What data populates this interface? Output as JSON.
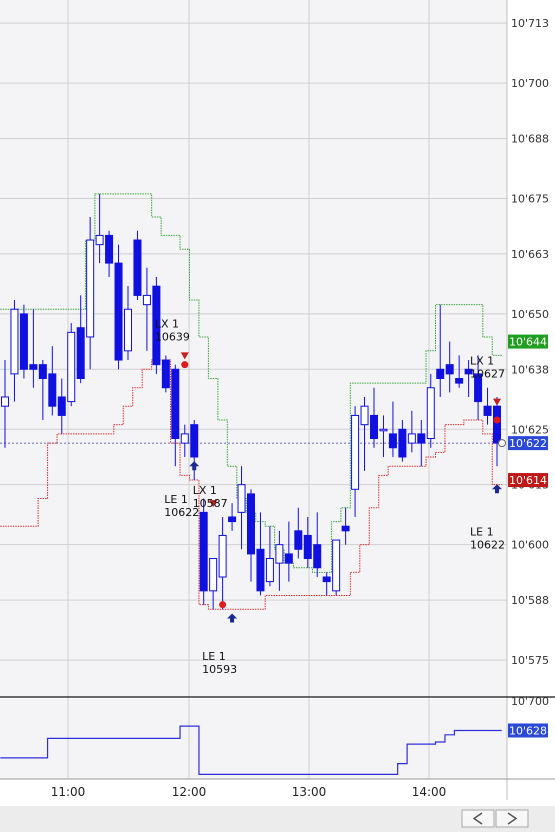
{
  "chart_data": [
    {
      "type": "candlestick",
      "title": "",
      "ylim": [
        10567,
        10718
      ],
      "y_ticks": [
        "10'713",
        "10'700",
        "10'688",
        "10'675",
        "10'663",
        "10'650",
        "10'638",
        "10'625",
        "10'613",
        "10'600",
        "10'588",
        "10'575"
      ],
      "y_tick_values": [
        10713,
        10700,
        10688,
        10675,
        10663,
        10650,
        10638,
        10625,
        10613,
        10600,
        10588,
        10575
      ],
      "time_grid_x": [
        "11:00",
        "12:00",
        "13:00",
        "14:00"
      ],
      "grid": true,
      "candles": [
        {
          "o": 10632,
          "h": 10640,
          "l": 10621,
          "c": 10630,
          "up": true
        },
        {
          "o": 10637,
          "h": 10653,
          "l": 10631,
          "c": 10651,
          "up": true
        },
        {
          "o": 10650,
          "h": 10652,
          "l": 10636,
          "c": 10638,
          "up": false
        },
        {
          "o": 10639,
          "h": 10651,
          "l": 10634,
          "c": 10638,
          "up": false
        },
        {
          "o": 10639,
          "h": 10640,
          "l": 10627,
          "c": 10636,
          "up": false
        },
        {
          "o": 10637,
          "h": 10643,
          "l": 10628,
          "c": 10630,
          "up": false
        },
        {
          "o": 10632,
          "h": 10636,
          "l": 10624,
          "c": 10628,
          "up": false
        },
        {
          "o": 10631,
          "h": 10648,
          "l": 10630,
          "c": 10646,
          "up": true
        },
        {
          "o": 10647,
          "h": 10654,
          "l": 10635,
          "c": 10636,
          "up": false
        },
        {
          "o": 10645,
          "h": 10671,
          "l": 10638,
          "c": 10666,
          "up": true
        },
        {
          "o": 10665,
          "h": 10676,
          "l": 10661,
          "c": 10667,
          "up": true
        },
        {
          "o": 10667,
          "h": 10668,
          "l": 10658,
          "c": 10661,
          "up": false
        },
        {
          "o": 10661,
          "h": 10665,
          "l": 10638,
          "c": 10640,
          "up": false
        },
        {
          "o": 10642,
          "h": 10656,
          "l": 10640,
          "c": 10651,
          "up": true
        },
        {
          "o": 10666,
          "h": 10668,
          "l": 10653,
          "c": 10654,
          "up": false
        },
        {
          "o": 10652,
          "h": 10660,
          "l": 10642,
          "c": 10654,
          "up": true
        },
        {
          "o": 10656,
          "h": 10658,
          "l": 10637,
          "c": 10639,
          "up": false
        },
        {
          "o": 10640,
          "h": 10641,
          "l": 10633,
          "c": 10634,
          "up": false
        },
        {
          "o": 10638,
          "h": 10639,
          "l": 10617,
          "c": 10623,
          "up": false
        },
        {
          "o": 10622,
          "h": 10626,
          "l": 10619,
          "c": 10624,
          "up": true
        },
        {
          "o": 10626,
          "h": 10627,
          "l": 10614,
          "c": 10619,
          "up": false
        },
        {
          "o": 10607,
          "h": 10610,
          "l": 10587,
          "c": 10590,
          "up": false
        },
        {
          "o": 10590,
          "h": 10597,
          "l": 10586,
          "c": 10597,
          "up": true
        },
        {
          "o": 10593,
          "h": 10606,
          "l": 10586,
          "c": 10602,
          "up": true
        },
        {
          "o": 10606,
          "h": 10609,
          "l": 10603,
          "c": 10605,
          "up": false
        },
        {
          "o": 10607,
          "h": 10617,
          "l": 10599,
          "c": 10613,
          "up": true
        },
        {
          "o": 10611,
          "h": 10612,
          "l": 10592,
          "c": 10598,
          "up": false
        },
        {
          "o": 10599,
          "h": 10607,
          "l": 10589,
          "c": 10590,
          "up": false
        },
        {
          "o": 10592,
          "h": 10604,
          "l": 10591,
          "c": 10597,
          "up": true
        },
        {
          "o": 10596,
          "h": 10603,
          "l": 10590,
          "c": 10600,
          "up": true
        },
        {
          "o": 10598,
          "h": 10605,
          "l": 10592,
          "c": 10596,
          "up": false
        },
        {
          "o": 10603,
          "h": 10608,
          "l": 10597,
          "c": 10599,
          "up": false
        },
        {
          "o": 10602,
          "h": 10606,
          "l": 10595,
          "c": 10597,
          "up": false
        },
        {
          "o": 10600,
          "h": 10607,
          "l": 10593,
          "c": 10595,
          "up": false
        },
        {
          "o": 10592,
          "h": 10594,
          "l": 10589,
          "c": 10593,
          "up": false
        },
        {
          "o": 10590,
          "h": 10601,
          "l": 10589,
          "c": 10601,
          "up": true
        },
        {
          "o": 10603,
          "h": 10608,
          "l": 10600,
          "c": 10604,
          "up": false
        },
        {
          "o": 10612,
          "h": 10630,
          "l": 10606,
          "c": 10628,
          "up": true
        },
        {
          "o": 10626,
          "h": 10632,
          "l": 10616,
          "c": 10630,
          "up": true
        },
        {
          "o": 10628,
          "h": 10634,
          "l": 10621,
          "c": 10623,
          "up": false
        },
        {
          "o": 10625,
          "h": 10628,
          "l": 10619,
          "c": 10625,
          "up": true
        },
        {
          "o": 10624,
          "h": 10631,
          "l": 10619,
          "c": 10621,
          "up": false
        },
        {
          "o": 10625,
          "h": 10627,
          "l": 10618,
          "c": 10619,
          "up": false
        },
        {
          "o": 10622,
          "h": 10629,
          "l": 10620,
          "c": 10624,
          "up": true
        },
        {
          "o": 10624,
          "h": 10627,
          "l": 10617,
          "c": 10622,
          "up": false
        },
        {
          "o": 10623,
          "h": 10637,
          "l": 10621,
          "c": 10634,
          "up": true
        },
        {
          "o": 10638,
          "h": 10652,
          "l": 10632,
          "c": 10636,
          "up": false
        },
        {
          "o": 10639,
          "h": 10644,
          "l": 10633,
          "c": 10637,
          "up": false
        },
        {
          "o": 10636,
          "h": 10641,
          "l": 10634,
          "c": 10635,
          "up": false
        },
        {
          "o": 10638,
          "h": 10640,
          "l": 10632,
          "c": 10637,
          "up": false
        },
        {
          "o": 10637,
          "h": 10641,
          "l": 10627,
          "c": 10631,
          "up": false
        },
        {
          "o": 10630,
          "h": 10634,
          "l": 10626,
          "c": 10628,
          "up": false
        },
        {
          "o": 10630,
          "h": 10632,
          "l": 10617,
          "c": 10622,
          "up": false
        }
      ],
      "upper_band": [
        10651,
        10651,
        10651,
        10651,
        10651,
        10651,
        10651,
        10651,
        10651,
        10666,
        10676,
        10676,
        10676,
        10676,
        10676,
        10676,
        10671,
        10667,
        10667,
        10664,
        10653,
        10645,
        10636,
        10627,
        10617,
        10610,
        10607,
        10605,
        10604,
        10599,
        10596,
        10595,
        10595,
        10594,
        10594,
        10605,
        10608,
        10635,
        10635,
        10635,
        10635,
        10635,
        10635,
        10635,
        10635,
        10642,
        10652,
        10652,
        10652,
        10652,
        10652,
        10645,
        10641
      ],
      "lower_band": [
        10604,
        10604,
        10604,
        10604,
        10610,
        10622,
        10624,
        10624,
        10624,
        10624,
        10624,
        10624,
        10626,
        10630,
        10634,
        10638,
        10640,
        10640,
        10622,
        10615,
        10614,
        10587,
        10586,
        10586,
        10586,
        10586,
        10586,
        10586,
        10589,
        10589,
        10589,
        10589,
        10589,
        10589,
        10589,
        10589,
        10589,
        10594,
        10600,
        10608,
        10615,
        10617,
        10617,
        10617,
        10617,
        10619,
        10620,
        10626,
        10626,
        10627,
        10627,
        10624,
        10613
      ],
      "markers": [
        {
          "type": "up-arrow",
          "bar": 20,
          "value": 10617
        },
        {
          "type": "up-arrow",
          "bar": 24,
          "value": 10584
        },
        {
          "type": "up-arrow",
          "bar": 52,
          "value": 10612
        },
        {
          "type": "down-arrow",
          "bar": 19,
          "value": 10641
        },
        {
          "type": "down-arrow",
          "bar": 22,
          "value": 10609
        },
        {
          "type": "down-arrow",
          "bar": 52,
          "value": 10631
        },
        {
          "type": "dot",
          "bar": 19,
          "value": 10639
        },
        {
          "type": "dot",
          "bar": 23,
          "value": 10587
        },
        {
          "type": "dot",
          "bar": 52,
          "value": 10627
        }
      ],
      "annotations": [
        {
          "line1": "LX 1",
          "line2": "10639",
          "bar": 17,
          "value": 10647
        },
        {
          "line1": "LX 1",
          "line2": "10587",
          "bar": 21,
          "value": 10611
        },
        {
          "line1": "LE 1",
          "line2": "10622",
          "bar": 18,
          "value": 10609
        },
        {
          "line1": "LE 1",
          "line2": "10593",
          "bar": 22,
          "value": 10575
        },
        {
          "line1": "LX 1",
          "line2": "10627",
          "bar": 57,
          "value": 10639
        },
        {
          "line1": "LE 1",
          "line2": "10622",
          "bar": 58,
          "value": 10602
        }
      ],
      "reference_level": 10622,
      "price_badges": [
        {
          "label": "10'644",
          "value": 10644,
          "color": "#1f9e1f"
        },
        {
          "label": "10'622",
          "value": 10622,
          "color": "#2a49d8"
        },
        {
          "label": "10'614",
          "value": 10614,
          "color": "#c21717"
        }
      ]
    },
    {
      "type": "line",
      "panel": "indicator",
      "y_top_label": "10'700",
      "badge": {
        "label": "10'628",
        "color": "#2a49d8"
      },
      "series_color": "#2e2ed8",
      "values": [
        0.28,
        0.28,
        0.28,
        0.28,
        0.28,
        0.55,
        0.55,
        0.55,
        0.55,
        0.55,
        0.55,
        0.55,
        0.55,
        0.55,
        0.55,
        0.55,
        0.55,
        0.55,
        0.55,
        0.72,
        0.72,
        0.05,
        0.05,
        0.05,
        0.05,
        0.05,
        0.05,
        0.05,
        0.05,
        0.05,
        0.05,
        0.05,
        0.05,
        0.05,
        0.05,
        0.05,
        0.05,
        0.05,
        0.05,
        0.05,
        0.05,
        0.05,
        0.2,
        0.47,
        0.47,
        0.47,
        0.5,
        0.6,
        0.66,
        0.66,
        0.66,
        0.66,
        0.66
      ]
    }
  ],
  "x_axis": {
    "labels": [
      "11:00",
      "12:00",
      "13:00",
      "14:00"
    ]
  },
  "scrollbar": {
    "left_icon": "chevron-left-icon",
    "right_icon": "chevron-right-icon"
  },
  "colors": {
    "candle": "#1010e0",
    "upper_band": "#3aa63a",
    "lower_band": "#dd3030",
    "grid": "#d0d0d0",
    "arrow": "#1c2a8f"
  }
}
